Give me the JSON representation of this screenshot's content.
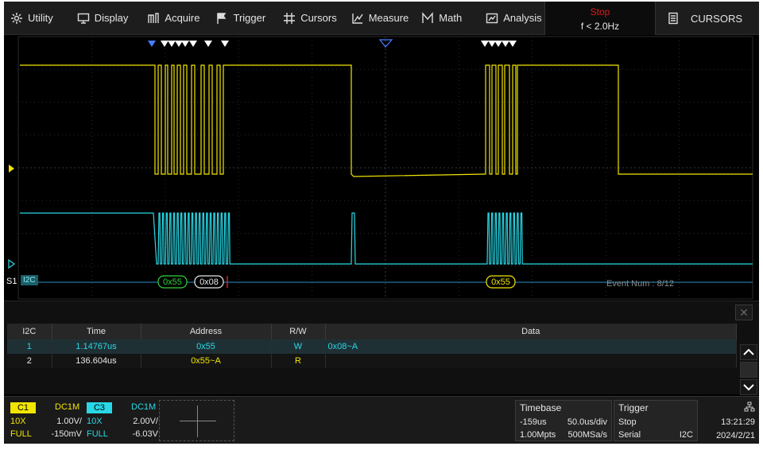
{
  "menu": {
    "items": [
      {
        "name": "utility",
        "label": "Utility",
        "icon": "gear-icon"
      },
      {
        "name": "display",
        "label": "Display",
        "icon": "monitor-icon"
      },
      {
        "name": "acquire",
        "label": "Acquire",
        "icon": "acquire-icon"
      },
      {
        "name": "trigger",
        "label": "Trigger",
        "icon": "trigger-flag-icon"
      },
      {
        "name": "cursors",
        "label": "Cursors",
        "icon": "hash-icon"
      },
      {
        "name": "measure",
        "label": "Measure",
        "icon": "measure-icon"
      },
      {
        "name": "math",
        "label": "Math",
        "icon": "math-icon"
      },
      {
        "name": "analysis",
        "label": "Analysis",
        "icon": "analysis-icon"
      }
    ],
    "run_state": "Stop",
    "frequency": "f < 2.0Hz",
    "cursors_button": "CURSORS",
    "run_state_color": "#e21a1a"
  },
  "waveform": {
    "bus_label": "S1",
    "bus_protocol": "I2C",
    "decode_markers": [
      "0x55",
      "0x08",
      "0x55"
    ],
    "event_num": "Event Num : 8/12",
    "ch1_color": "#f2e600",
    "ch3_color": "#29d8e6"
  },
  "decode": {
    "headers": [
      "I2C",
      "Time",
      "Address",
      "R/W",
      "Data"
    ],
    "rows": [
      {
        "idx": "1",
        "time": "1.14767us",
        "address": "0x55",
        "rw": "W",
        "data": "0x08~A"
      },
      {
        "idx": "2",
        "time": "136.604us",
        "address": "0x55~A",
        "rw": "R",
        "data": ""
      }
    ]
  },
  "channels": {
    "c1": {
      "tag": "C1",
      "coupling": "DC1M",
      "probe": "10X",
      "scale": "1.00V/",
      "bw": "FULL",
      "offset": "-150mV"
    },
    "c3": {
      "tag": "C3",
      "coupling": "DC1M",
      "probe": "10X",
      "scale": "2.00V/",
      "bw": "FULL",
      "offset": "-6.03V"
    }
  },
  "timebase": {
    "title": "Timebase",
    "delay": "-159us",
    "scale": "50.0us/div",
    "memory": "1.00Mpts",
    "rate": "500MSa/s"
  },
  "trigger": {
    "title": "Trigger",
    "mode": "Stop",
    "type": "Serial",
    "source": "I2C"
  },
  "clock": {
    "time": "13:21:29",
    "date": "2024/2/21"
  }
}
